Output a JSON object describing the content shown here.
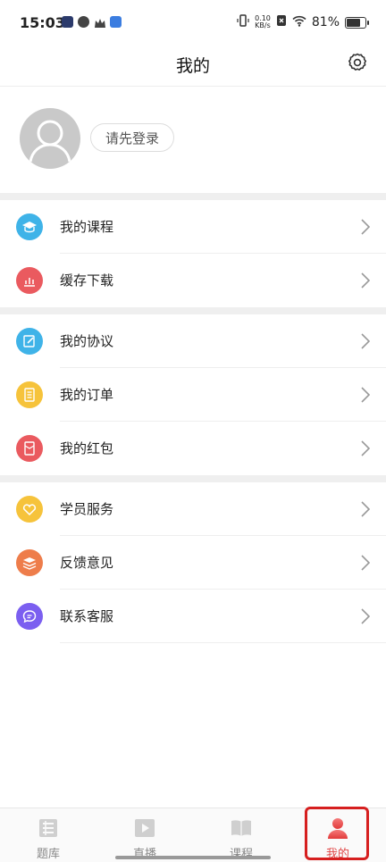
{
  "status_bar": {
    "time": "15:03",
    "speed_value": "0.10",
    "speed_unit": "KB/s",
    "battery_text": "81%",
    "battery_level": 0.81
  },
  "header": {
    "title": "我的",
    "settings_icon": "gear-icon"
  },
  "profile": {
    "login_label": "请先登录"
  },
  "menu_groups": [
    [
      {
        "label": "我的课程",
        "icon": "graduation-cap-icon",
        "color": "#3fb3e8"
      },
      {
        "label": "缓存下载",
        "icon": "bar-chart-icon",
        "color": "#ea5a5f"
      }
    ],
    [
      {
        "label": "我的协议",
        "icon": "document-edit-icon",
        "color": "#3fb3e8"
      },
      {
        "label": "我的订单",
        "icon": "order-list-icon",
        "color": "#f6c33b"
      },
      {
        "label": "我的红包",
        "icon": "red-envelope-icon",
        "color": "#ea5a5f"
      }
    ],
    [
      {
        "label": "学员服务",
        "icon": "heart-icon",
        "color": "#f6c33b"
      },
      {
        "label": "反馈意见",
        "icon": "layers-icon",
        "color": "#ee7d4b"
      },
      {
        "label": "联系客服",
        "icon": "chat-icon",
        "color": "#7b5ff0"
      }
    ]
  ],
  "tabs": [
    {
      "label": "题库",
      "icon": "question-bank-icon"
    },
    {
      "label": "直播",
      "icon": "live-play-icon"
    },
    {
      "label": "课程",
      "icon": "book-icon"
    },
    {
      "label": "我的",
      "icon": "user-icon",
      "active": true
    }
  ],
  "colors": {
    "active": "#e04848",
    "inactive": "#888888"
  }
}
